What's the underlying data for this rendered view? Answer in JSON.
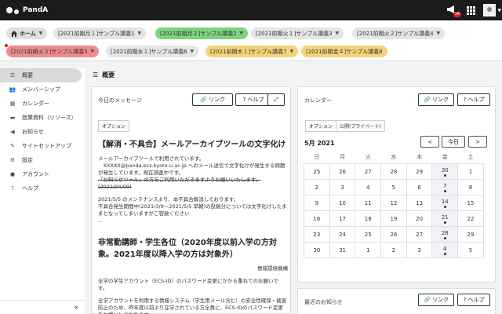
{
  "header": {
    "app_name": "PandA",
    "notification_count": "14"
  },
  "sites": {
    "home_label": "ホーム",
    "row1": [
      {
        "label": "[2021前期月１]サンプル講義1",
        "color": "gray"
      },
      {
        "label": "[2021前期月２]サンプル講義2",
        "color": "green"
      },
      {
        "label": "[2021前期火１]サンプル講義3",
        "color": "gray"
      },
      {
        "label": "[2021前期火２]サンプル講義4",
        "color": "gray"
      }
    ],
    "row2": [
      {
        "label": "[2021前期火３]サンプル講義5",
        "color": "red"
      },
      {
        "label": "[2021前期水１]サンプル講義6",
        "color": "gray"
      },
      {
        "label": "[2021前期木１]サンプル講義7",
        "color": "yellow"
      },
      {
        "label": "[2021前期金４]サンプル講義8",
        "color": "yellow"
      }
    ]
  },
  "sidebar": {
    "items": [
      {
        "label": "概要",
        "icon": "list-icon"
      },
      {
        "label": "メンバーシップ",
        "icon": "users-icon"
      },
      {
        "label": "カレンダー",
        "icon": "calendar-icon"
      },
      {
        "label": "授業資料（リソース）",
        "icon": "folder-icon"
      },
      {
        "label": "お知らせ",
        "icon": "megaphone-icon"
      },
      {
        "label": "サイトセットアップ",
        "icon": "wrench-icon"
      },
      {
        "label": "設定",
        "icon": "gear-icon"
      },
      {
        "label": "アカウント",
        "icon": "account-icon"
      },
      {
        "label": "ヘルプ",
        "icon": "help-icon"
      }
    ],
    "collapse_label": "«"
  },
  "main": {
    "title": "概要"
  },
  "messages": {
    "title": "今日のメッセージ",
    "link_label": "リンク",
    "help_label": "ヘルプ",
    "options_tab": "オプション",
    "heading1": "【解消・不具合】メールアーカイブツールの文字化け",
    "p1": "メールアーカイブツールで利用されています。",
    "p2": "　XXXXX@panda.ecs.kyoto-u.ac.jp へのメール送信で文字化けが発生する問題が発生しています。現在調査中です。",
    "p3": "「お知らせツール」の方をご利用いただきますようお願いいたします。",
    "p4": "(2021/04/09)",
    "p5": "2021/5/5 のメンテナンスより、本不具合解消しております。",
    "p6": "不具合発生期間中(2021/3/9～2021/5/5 早朝)の投稿分については文字化けしたままとなってしまいますがご容赦ください",
    "p7": "...",
    "heading2": "非常勤講師・学生各位（2020年度以前入学の方対象。2021年度以降入学の方は対象外）",
    "org": "情報環境機構",
    "p8": "全学の学生アカウント（ECS-ID）のパスワード変更にかかる重ねてのお願いです。",
    "p9": "全学アカウントを利用する情報システム（学生用メール含む）の安全性確保・被害防止のため、昨年度以前より在学されている方全員に、ECS-IDのパスワード変更をお願いしております。"
  },
  "calendar": {
    "title": "カレンダー",
    "link_label": "リンク",
    "help_label": "ヘルプ",
    "tabs": [
      "オプション",
      "公開(プライベート)"
    ],
    "month_label": "5月 2021",
    "prev_label": "<",
    "today_label": "今日",
    "next_label": ">",
    "weekdays": [
      "日",
      "月",
      "火",
      "水",
      "木",
      "金",
      "土"
    ],
    "weeks": [
      [
        "25",
        "26",
        "27",
        "28",
        "29",
        "30",
        "1"
      ],
      [
        "2",
        "3",
        "4",
        "5",
        "6",
        "7",
        "8"
      ],
      [
        "9",
        "10",
        "11",
        "12",
        "13",
        "14",
        "15"
      ],
      [
        "16",
        "17",
        "18",
        "19",
        "20",
        "21",
        "22"
      ],
      [
        "23",
        "24",
        "25",
        "26",
        "27",
        "28",
        "29"
      ],
      [
        "30",
        "31",
        "1",
        "2",
        "3",
        "4",
        "5"
      ]
    ],
    "event_column": 5
  },
  "announcements": {
    "title": "最近のお知らせ",
    "link_label": "リンク",
    "help_label": "ヘルプ"
  }
}
